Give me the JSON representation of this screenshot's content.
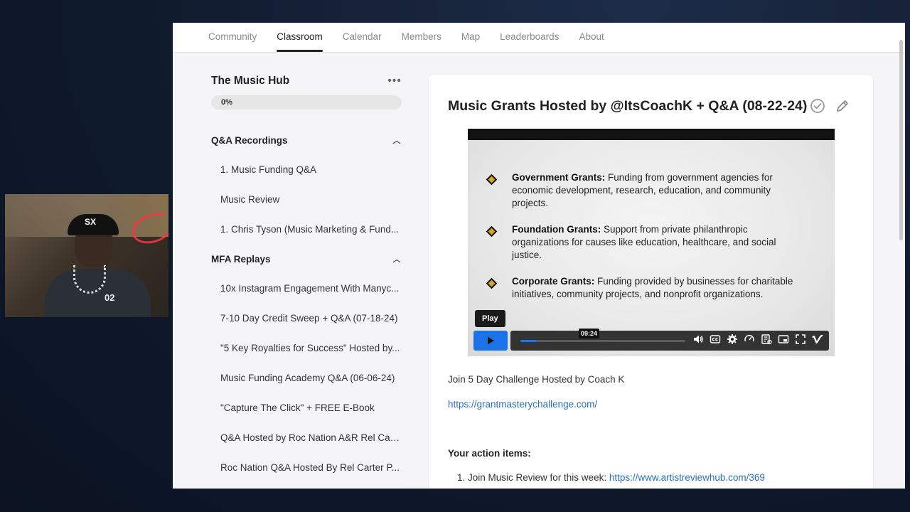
{
  "nav": {
    "tabs": [
      {
        "label": "Community"
      },
      {
        "label": "Classroom"
      },
      {
        "label": "Calendar"
      },
      {
        "label": "Members"
      },
      {
        "label": "Map"
      },
      {
        "label": "Leaderboards"
      },
      {
        "label": "About"
      }
    ],
    "active_tab": "Classroom"
  },
  "webcam": {
    "cap_text": "SX",
    "jersey_text": "02"
  },
  "sidebar": {
    "course_title": "The Music Hub",
    "more_icon": "more-horizontal-icon",
    "progress": {
      "label": "0%",
      "value": 0
    },
    "sections": [
      {
        "title": "Q&A Recordings",
        "icon": "chevron-up-icon",
        "lessons": [
          "1. Music Funding Q&A",
          "Music Review",
          "1. Chris Tyson (Music Marketing & Fund..."
        ]
      },
      {
        "title": "MFA Replays",
        "icon": "chevron-up-icon",
        "lessons": [
          "10x Instagram Engagement With Manyc...",
          "7-10 Day Credit Sweep + Q&A (07-18-24)",
          "\"5 Key Royalties for Success\" Hosted by...",
          "Music Funding Academy Q&A (06-06-24)",
          "\"Capture The Click\" + FREE E-Book",
          "Q&A Hosted by Roc Nation A&R Rel Cart...",
          "Roc Nation Q&A Hosted By Rel Carter P..."
        ]
      }
    ]
  },
  "lesson": {
    "title": "Music Grants Hosted by @ItsCoachK + Q&A (08-22-24)",
    "video": {
      "bullets": [
        {
          "heading": "Government Grants:",
          "text": " Funding from government agencies for economic development, research, education, and community projects."
        },
        {
          "heading": "Foundation Grants:",
          "text": " Support from private philanthropic organizations for causes like education, healthcare, and social justice."
        },
        {
          "heading": "Corporate Grants:",
          "text": " Funding provided by businesses for charitable initiatives, community projects, and nonprofit organizations."
        }
      ],
      "play_tooltip": "Play",
      "timestamp": "09:24",
      "progress": 0.1,
      "accent_color": "#1a73e8",
      "controls": [
        "volume-icon",
        "captions-icon",
        "settings-icon",
        "speed-icon",
        "transcript-icon",
        "pip-icon",
        "fullscreen-icon",
        "vimeo-icon"
      ]
    },
    "description": "Join 5 Day Challenge Hosted by Coach K",
    "link": "https://grantmasterychallenge.com/",
    "action_heading": "Your action items:",
    "action_items": [
      {
        "prefix": "1. Join Music Review for this week: ",
        "link": "https://www.artistreviewhub.com/369"
      }
    ]
  }
}
